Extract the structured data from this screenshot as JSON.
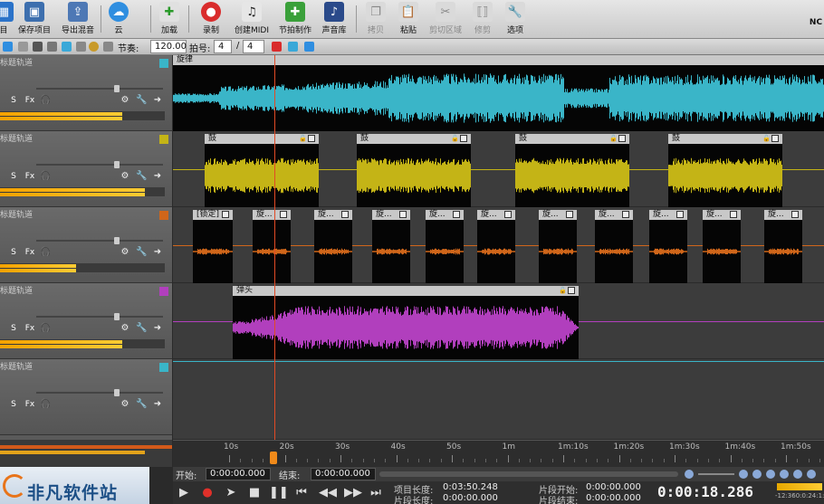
{
  "toolbar": {
    "buttons": [
      {
        "label": "目",
        "icon": "new-project-icon"
      },
      {
        "label": "保存项目",
        "icon": "save-project-icon"
      },
      {
        "label": "导出混音",
        "icon": "export-mix-icon"
      },
      {
        "label": "云",
        "icon": "cloud-icon"
      },
      {
        "label": "加载",
        "icon": "load-icon"
      },
      {
        "label": "录制",
        "icon": "record-icon"
      },
      {
        "label": "创建MIDI",
        "icon": "create-midi-icon"
      },
      {
        "label": "节拍制作",
        "icon": "beat-maker-icon"
      },
      {
        "label": "声音库",
        "icon": "sound-library-icon"
      },
      {
        "label": "拷贝",
        "icon": "copy-icon"
      },
      {
        "label": "粘贴",
        "icon": "paste-icon"
      },
      {
        "label": "剪切区域",
        "icon": "cut-region-icon"
      },
      {
        "label": "修剪",
        "icon": "trim-icon"
      },
      {
        "label": "选项",
        "icon": "options-icon"
      }
    ],
    "corner_label": "NC"
  },
  "subbar": {
    "tempo_label": "节奏:",
    "tempo_value": "120.00",
    "meter_label": "拍号:",
    "meter_num": "4",
    "meter_slash": "/",
    "meter_den": "4"
  },
  "tracks": [
    {
      "title": "标题轨道",
      "color": "#3ab5c8",
      "s": "S",
      "fx": "Fx",
      "meter": 0.74
    },
    {
      "title": "标题轨道",
      "color": "#c4b416",
      "s": "S",
      "fx": "Fx",
      "meter": 0.88
    },
    {
      "title": "标题轨道",
      "color": "#d0661a",
      "s": "S",
      "fx": "Fx",
      "meter": 0.46
    },
    {
      "title": "标题轨道",
      "color": "#b13fbd",
      "s": "S",
      "fx": "Fx",
      "meter": 0.74
    },
    {
      "title": "标题轨道",
      "color": "#3ab5c8",
      "s": "S",
      "fx": "Fx",
      "meter": 0
    }
  ],
  "clips": {
    "lane1": [
      {
        "label": "旋律"
      }
    ],
    "lane2": [
      {
        "label": "鼓"
      },
      {
        "label": "鼓"
      },
      {
        "label": "鼓"
      },
      {
        "label": "鼓"
      }
    ],
    "lane3": [
      {
        "label": "[锁定]"
      },
      {
        "label": "旋..."
      },
      {
        "label": "旋..."
      },
      {
        "label": "旋..."
      },
      {
        "label": "旋..."
      },
      {
        "label": "旋..."
      },
      {
        "label": "旋..."
      },
      {
        "label": "旋..."
      },
      {
        "label": "旋..."
      },
      {
        "label": "旋..."
      },
      {
        "label": "旋..."
      }
    ],
    "lane4": [
      {
        "label": "弹头"
      }
    ]
  },
  "ruler": {
    "labels": [
      "10s",
      "20s",
      "30s",
      "40s",
      "50s",
      "1m",
      "1m:10s",
      "1m:20s",
      "1m:30s",
      "1m:40s",
      "1m:50s"
    ]
  },
  "position": {
    "start_label": "开始:",
    "start_value": "0:00:00.000",
    "end_label": "结束:",
    "end_value": "0:00:00.000"
  },
  "info": {
    "project_length_label": "项目长度:",
    "project_length_value": "0:03:50.248",
    "clip_length_label": "片段长度:",
    "clip_length_value": "0:00:00.000",
    "clip_start_label": "片段开始:",
    "clip_start_value": "0:00:00.000",
    "clip_end_label": "片段结束:",
    "clip_end_value": "0:00:00.000",
    "clock": "0:00:18.286",
    "level_readout": "-12:360:0:24:1:8"
  },
  "watermark": {
    "text": "非凡软件站"
  }
}
